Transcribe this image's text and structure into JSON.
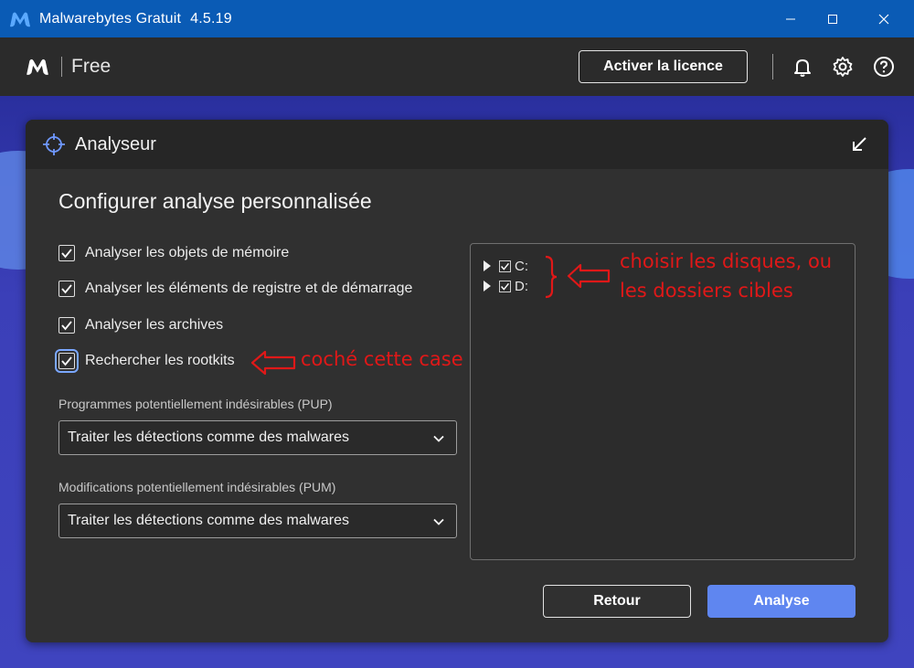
{
  "window": {
    "app_name": "Malwarebytes Gratuit",
    "version": "4.5.19"
  },
  "header": {
    "edition": "Free",
    "activate_label": "Activer la licence"
  },
  "panel": {
    "title": "Analyseur",
    "config_title": "Configurer analyse personnalisée",
    "options": [
      {
        "label": "Analyser les objets de mémoire",
        "checked": true
      },
      {
        "label": "Analyser les éléments de registre et de démarrage",
        "checked": true
      },
      {
        "label": "Analyser les archives",
        "checked": true
      },
      {
        "label": "Rechercher les rootkits",
        "checked": true
      }
    ],
    "pup": {
      "label": "Programmes potentiellement indésirables (PUP)",
      "value": "Traiter les détections comme des malwares"
    },
    "pum": {
      "label": "Modifications potentiellement indésirables (PUM)",
      "value": "Traiter les détections comme des malwares"
    },
    "drives": [
      {
        "label": "C:",
        "checked": true
      },
      {
        "label": "D:",
        "checked": true
      }
    ],
    "back_label": "Retour",
    "scan_label": "Analyse"
  },
  "annotations": {
    "rootkit_note": "coché cette case",
    "drives_note_line1": "choisir les disques, ou",
    "drives_note_line2": "les dossiers cibles"
  },
  "colors": {
    "titlebar": "#0a5bb5",
    "accent_button": "#5f86f0",
    "annotation": "#e01818"
  }
}
